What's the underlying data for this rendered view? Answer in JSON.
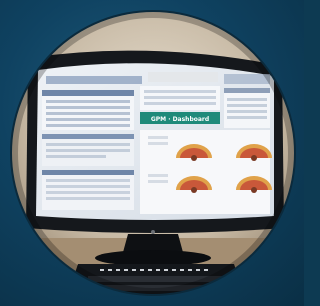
{
  "photo": {
    "subject": "desktop-monitor-dashboard",
    "colors": {
      "background": "#0f4261",
      "frame": "#111418",
      "teal_banner": "#1f8a7a",
      "gauge_red": "#c9583a",
      "gauge_amber": "#e0a24a"
    },
    "screen": {
      "banner_text": "GPM · Dashboard"
    }
  }
}
